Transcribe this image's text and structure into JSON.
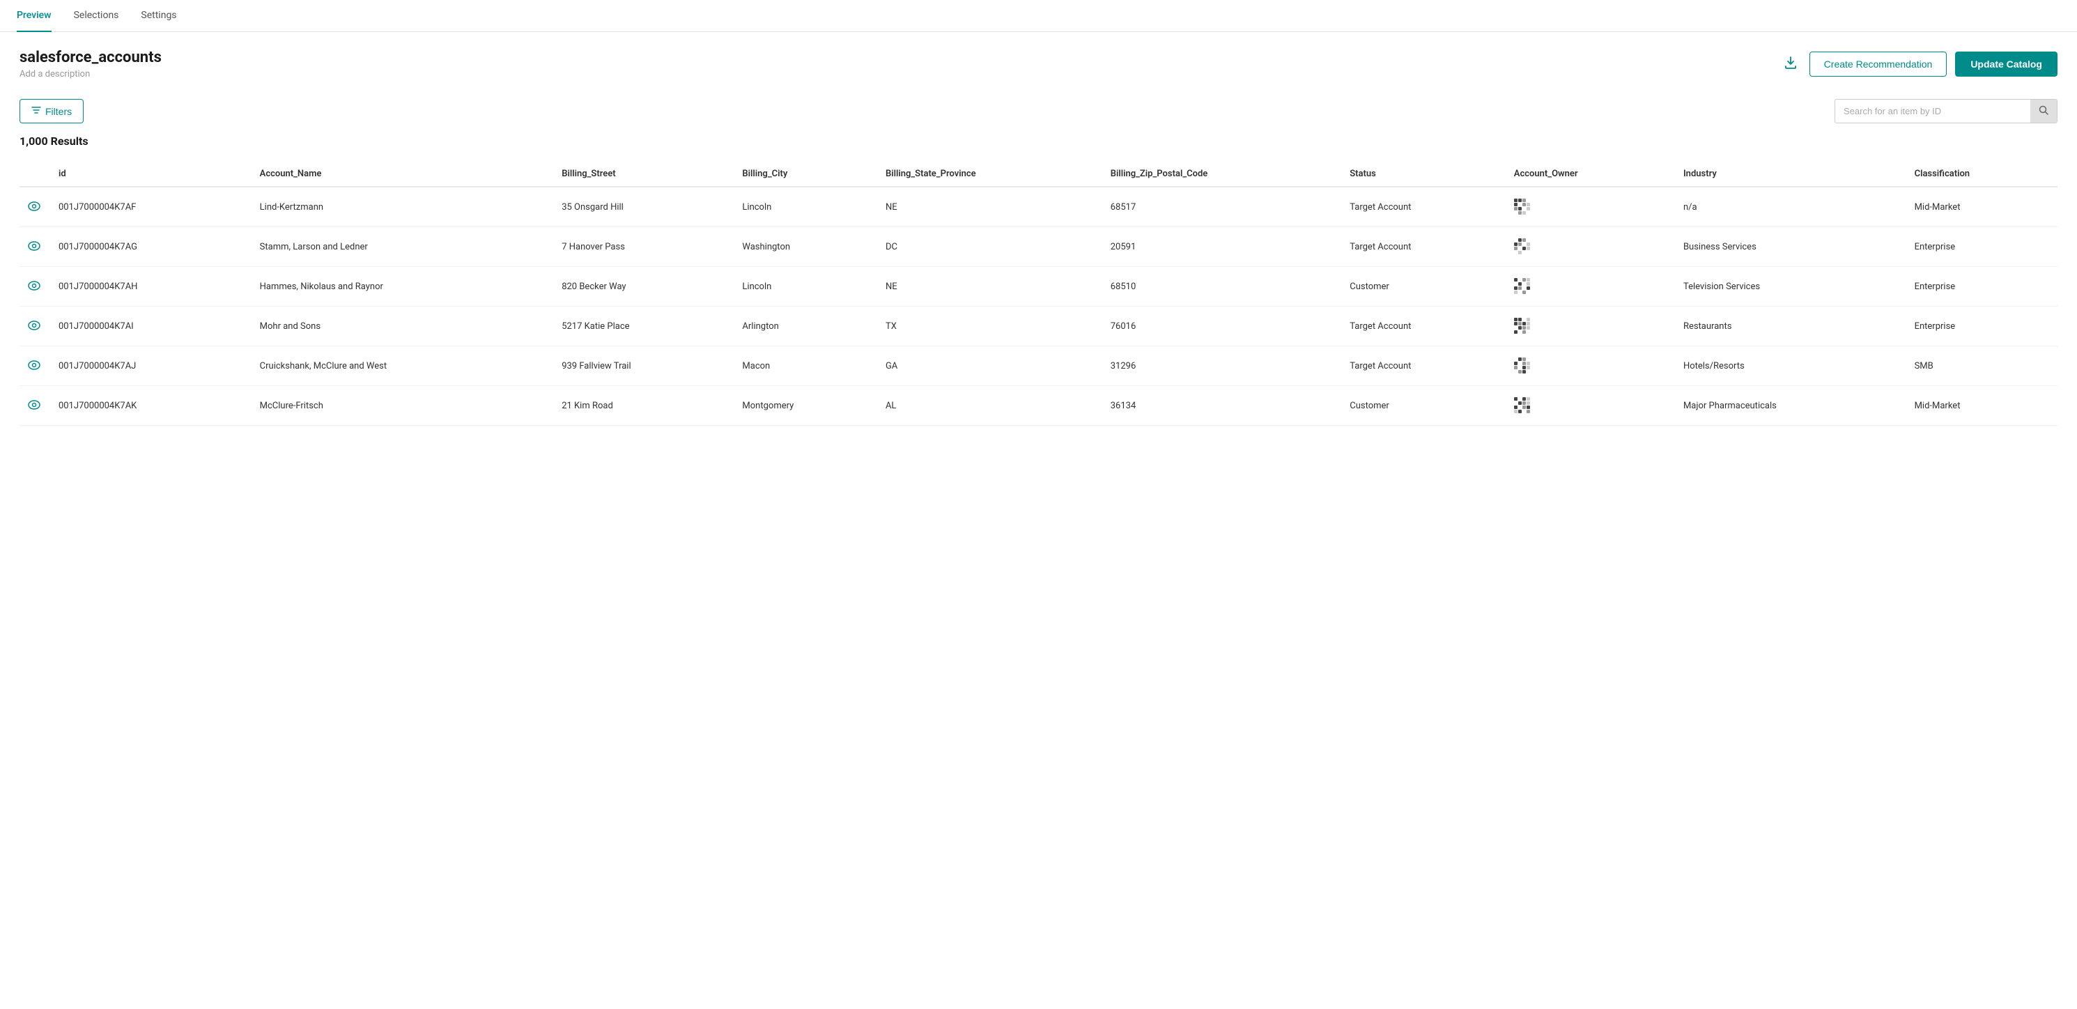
{
  "tabs": [
    {
      "label": "Preview",
      "active": true
    },
    {
      "label": "Selections",
      "active": false
    },
    {
      "label": "Settings",
      "active": false
    }
  ],
  "title": "salesforce_accounts",
  "description": "Add a description",
  "actions": {
    "download_label": "⬇",
    "create_recommendation": "Create Recommendation",
    "update_catalog": "Update Catalog"
  },
  "toolbar": {
    "filters_label": "Filters",
    "search_placeholder": "Search for an item by ID"
  },
  "results_count": "1,000 Results",
  "table": {
    "columns": [
      "id",
      "Account_Name",
      "Billing_Street",
      "Billing_City",
      "Billing_State_Province",
      "Billing_Zip_Postal_Code",
      "Status",
      "Account_Owner",
      "Industry",
      "Classification"
    ],
    "rows": [
      {
        "id": "001J7000004K7AF",
        "account_name": "Lind-Kertzmann",
        "billing_street": "35 Onsgard Hill",
        "billing_city": "Lincoln",
        "billing_state": "NE",
        "billing_zip": "68517",
        "status": "Target Account",
        "industry": "n/a",
        "classification": "Mid-Market"
      },
      {
        "id": "001J7000004K7AG",
        "account_name": "Stamm, Larson and Ledner",
        "billing_street": "7 Hanover Pass",
        "billing_city": "Washington",
        "billing_state": "DC",
        "billing_zip": "20591",
        "status": "Target Account",
        "industry": "Business Services",
        "classification": "Enterprise"
      },
      {
        "id": "001J7000004K7AH",
        "account_name": "Hammes, Nikolaus and Raynor",
        "billing_street": "820 Becker Way",
        "billing_city": "Lincoln",
        "billing_state": "NE",
        "billing_zip": "68510",
        "status": "Customer",
        "industry": "Television Services",
        "classification": "Enterprise"
      },
      {
        "id": "001J7000004K7AI",
        "account_name": "Mohr and Sons",
        "billing_street": "5217 Katie Place",
        "billing_city": "Arlington",
        "billing_state": "TX",
        "billing_zip": "76016",
        "status": "Target Account",
        "industry": "Restaurants",
        "classification": "Enterprise"
      },
      {
        "id": "001J7000004K7AJ",
        "account_name": "Cruickshank, McClure and West",
        "billing_street": "939 Fallview Trail",
        "billing_city": "Macon",
        "billing_state": "GA",
        "billing_zip": "31296",
        "status": "Target Account",
        "industry": "Hotels/Resorts",
        "classification": "SMB"
      },
      {
        "id": "001J7000004K7AK",
        "account_name": "McClure-Fritsch",
        "billing_street": "21 Kim Road",
        "billing_city": "Montgomery",
        "billing_state": "AL",
        "billing_zip": "36134",
        "status": "Customer",
        "industry": "Major Pharmaceuticals",
        "classification": "Mid-Market"
      }
    ]
  }
}
